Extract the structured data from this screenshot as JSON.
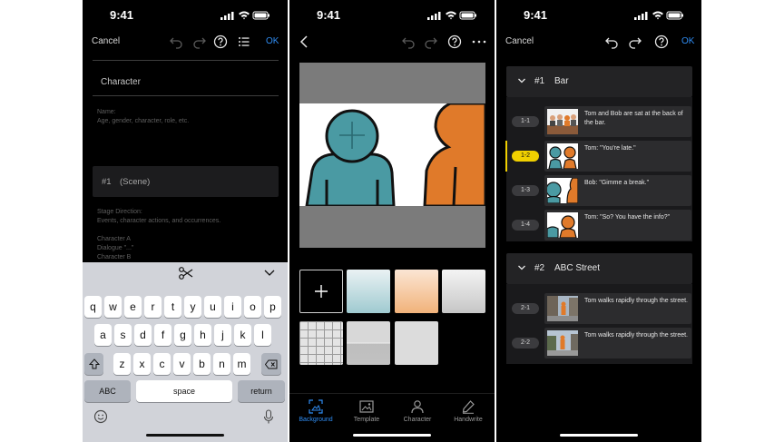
{
  "status": {
    "time": "9:41"
  },
  "phone1": {
    "nav": {
      "cancel": "Cancel",
      "ok": "OK"
    },
    "character_label": "Character",
    "name_hint": "Name:",
    "name_hint2": "Age, gender, character, role, etc.",
    "scene": {
      "num": "#1",
      "label": "(Scene)"
    },
    "stage_hint": "Stage Direction:",
    "stage_hint2": "Events, character actions, and occurrences.",
    "char_a": "Character A",
    "dialogue": "Dialogue \"...\"",
    "char_b": "Character B",
    "keyboard": {
      "row1": [
        "q",
        "w",
        "e",
        "r",
        "t",
        "y",
        "u",
        "i",
        "o",
        "p"
      ],
      "row2": [
        "a",
        "s",
        "d",
        "f",
        "g",
        "h",
        "j",
        "k",
        "l"
      ],
      "row3": [
        "z",
        "x",
        "c",
        "v",
        "b",
        "n",
        "m"
      ],
      "abc": "ABC",
      "space": "space",
      "return": "return"
    }
  },
  "phone2": {
    "tabs": [
      {
        "label": "Background",
        "icon": "background-icon"
      },
      {
        "label": "Template",
        "icon": "template-icon"
      },
      {
        "label": "Character",
        "icon": "character-icon"
      },
      {
        "label": "Handwrite",
        "icon": "handwrite-icon"
      }
    ],
    "colors": {
      "accent": "#2f8cf2",
      "teal_char": "#4a9aa3",
      "orange_char": "#e07a2a"
    }
  },
  "phone3": {
    "nav": {
      "cancel": "Cancel",
      "ok": "OK"
    },
    "sections": [
      {
        "num": "#1",
        "name": "Bar",
        "cuts": [
          {
            "id": "1-1",
            "text": "Tom and Bob are sat at the back of the bar."
          },
          {
            "id": "1-2",
            "text": "Tom: \"You're late.\""
          },
          {
            "id": "1-3",
            "text": "Bob: \"Gimme a break.\""
          },
          {
            "id": "1-4",
            "text": "Tom: \"So? You have the info?\""
          }
        ]
      },
      {
        "num": "#2",
        "name": "ABC Street",
        "cuts": [
          {
            "id": "2-1",
            "text": "Tom walks rapidly through the street."
          },
          {
            "id": "2-2",
            "text": "Tom walks rapidly through the street."
          }
        ]
      }
    ],
    "colors": {
      "highlight": "#f0d000"
    }
  }
}
